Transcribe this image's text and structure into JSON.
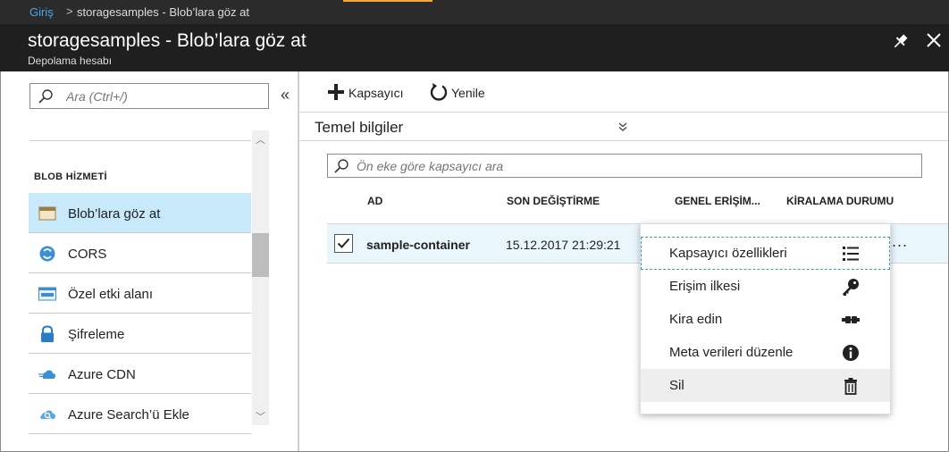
{
  "breadcrumb": {
    "home": "Giriş",
    "separator": ">",
    "current": "storagesamples - Blob’lara göz at"
  },
  "blade": {
    "title": "storagesamples - Blob’lara göz at",
    "subtitle": "Depolama hesabı",
    "pin_icon": "pin-icon",
    "close_icon": "close-icon"
  },
  "menu": {
    "search_placeholder": "Ara (Ctrl+/)",
    "collapse_label": "«",
    "section_label": "BLOB HİZMETİ",
    "items": [
      {
        "label": "Blob’lara göz at",
        "icon": "container-icon",
        "active": true
      },
      {
        "label": "CORS",
        "icon": "cors-icon"
      },
      {
        "label": "Özel etki alanı",
        "icon": "www-icon"
      },
      {
        "label": "Şifreleme",
        "icon": "lock-icon"
      },
      {
        "label": "Azure CDN",
        "icon": "cdn-cloud-icon"
      },
      {
        "label": "Azure Search’ü Ekle",
        "icon": "search-cloud-icon"
      }
    ]
  },
  "toolbar": {
    "add_label": "Kapsayıcı",
    "refresh_label": "Yenile"
  },
  "essentials": {
    "label": "Temel bilgiler",
    "toggle_glyph": "»"
  },
  "container_search": {
    "placeholder": "Ön eke göre kapsayıcı ara"
  },
  "table": {
    "columns": [
      "AD",
      "SON DEĞİŞTİRME",
      "GENEL ERİŞİM...",
      "KİRALAMA DURUMU"
    ],
    "rows": [
      {
        "name": "sample-container",
        "modified": "15.12.2017 21:29:21",
        "checked": true
      }
    ],
    "more_glyph": "..."
  },
  "context_menu": {
    "items": [
      {
        "label": "Kapsayıcı özellikleri",
        "icon": "list-icon"
      },
      {
        "label": "Erişim ilkesi",
        "icon": "key-icon"
      },
      {
        "label": "Kira edin",
        "icon": "lease-icon"
      },
      {
        "label": "Meta verileri düzenle",
        "icon": "info-icon"
      },
      {
        "label": "Sil",
        "icon": "trash-icon"
      }
    ]
  },
  "colors": {
    "accent_orange": "#f2a93b",
    "link_blue": "#4aa8e8",
    "selected_bg": "#c7e9f9",
    "row_bg": "#e9f6fc"
  }
}
